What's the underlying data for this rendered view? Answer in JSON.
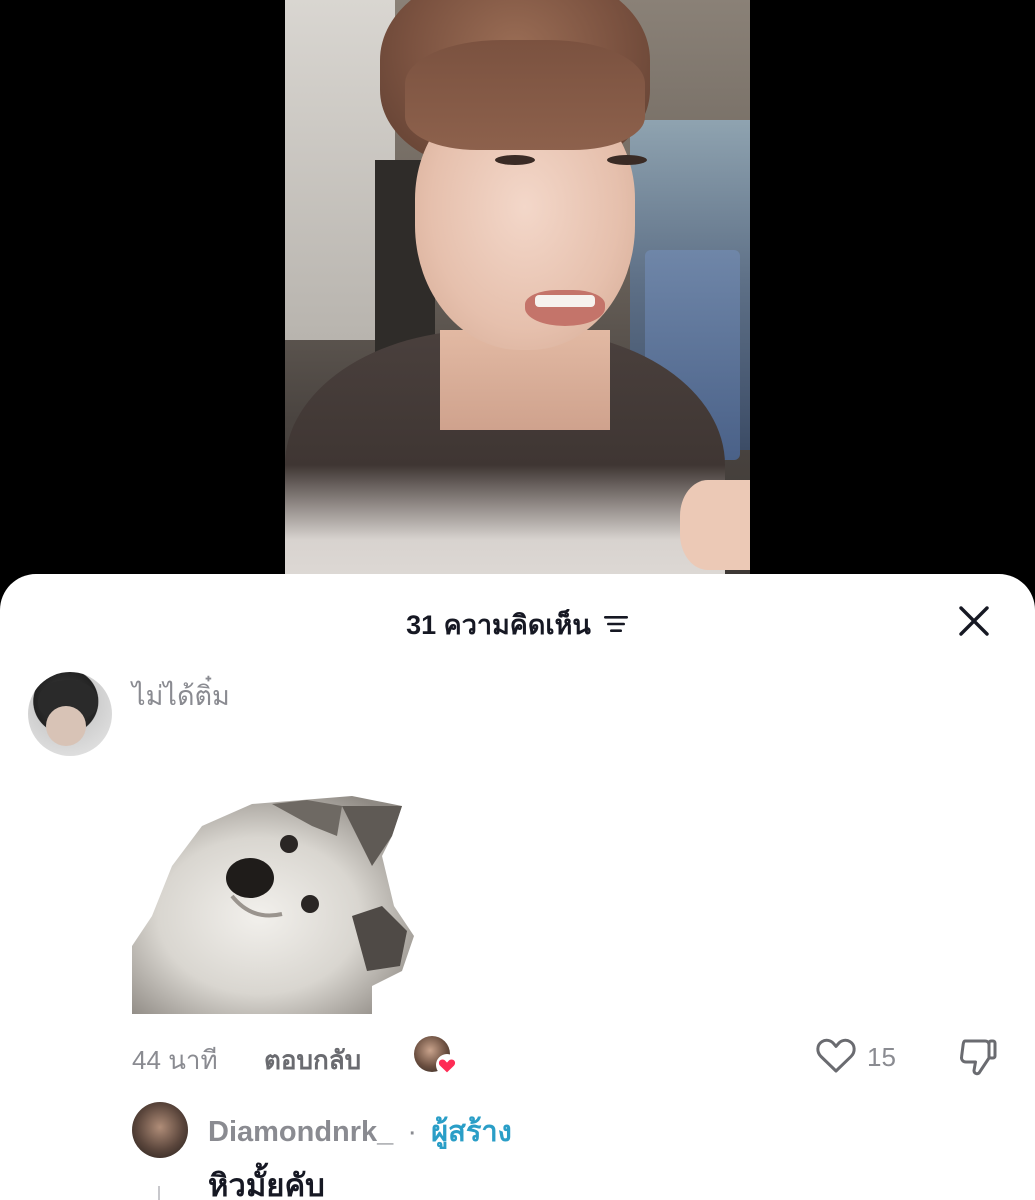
{
  "sheet": {
    "title": "31 ความคิดเห็น",
    "icons": {
      "sort": "sort-lines-icon",
      "close": "close-icon"
    }
  },
  "comment": {
    "username": "ไม่ได้ติ๋ม",
    "time": "44 นาที",
    "reply_label": "ตอบกลับ",
    "like_count": "15",
    "icons": {
      "like": "heart-outline-icon",
      "dislike": "thumbs-down-icon",
      "creator_liked": "heart-filled-icon"
    },
    "sticker": "dog-sticker"
  },
  "reply": {
    "username": "Diamondnrk_",
    "separator": "·",
    "creator_label": "ผู้สร้าง",
    "text": "หิวมั้ยคับ"
  },
  "colors": {
    "accent_blue": "#2a9ec7",
    "heart_red": "#fe2c55",
    "muted_text": "#8a8b91"
  }
}
